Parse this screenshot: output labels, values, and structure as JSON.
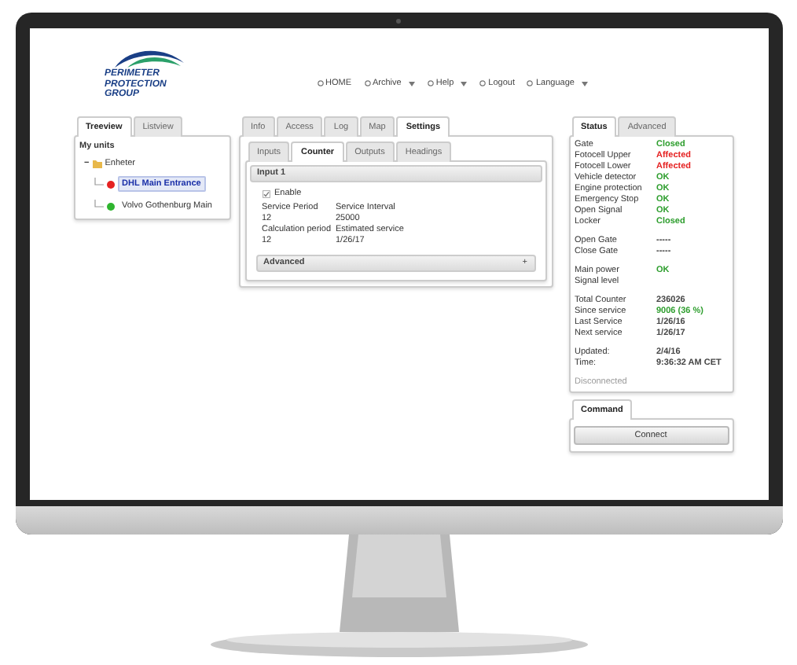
{
  "logo": {
    "lines": [
      "PERIMETER",
      "PROTECTION",
      "GROUP"
    ]
  },
  "nav": [
    {
      "label": "HOME",
      "dropdown": false
    },
    {
      "label": "Archive",
      "dropdown": true
    },
    {
      "label": "Help",
      "dropdown": true
    },
    {
      "label": "Logout",
      "dropdown": false
    },
    {
      "label": "Language",
      "dropdown": true
    }
  ],
  "left_panel": {
    "tabs": [
      {
        "label": "Treeview",
        "selected": true
      },
      {
        "label": "Listview",
        "selected": false
      }
    ],
    "heading": "My units",
    "tree": [
      {
        "label": "Enheter",
        "expanded": true,
        "toggle": "−",
        "children": [
          {
            "label": "DHL Main Entrance",
            "color": "#e52222",
            "selected": true
          },
          {
            "label": "Volvo Gothenburg Main",
            "color": "#2fb52f",
            "selected": false
          }
        ]
      }
    ]
  },
  "settings_panel": {
    "tabs": [
      {
        "label": "Info",
        "selected": false
      },
      {
        "label": "Access",
        "selected": false
      },
      {
        "label": "Log",
        "selected": false
      },
      {
        "label": "Map",
        "selected": false
      },
      {
        "label": "Settings",
        "selected": true
      }
    ],
    "subtabs": [
      {
        "label": "Inputs",
        "selected": false
      },
      {
        "label": "Counter",
        "selected": true
      },
      {
        "label": "Outputs",
        "selected": false
      },
      {
        "label": "Headings",
        "selected": false
      }
    ],
    "section": "Input 1",
    "enable": {
      "label": "Enable",
      "checked": true
    },
    "fields": [
      {
        "label": "Service Period",
        "value": "12"
      },
      {
        "label": "Service Interval",
        "value": "25000"
      },
      {
        "label": "Calculation period",
        "value": "12"
      },
      {
        "label": "Estimated service",
        "value": "1/26/17"
      }
    ],
    "advanced": {
      "label": "Advanced",
      "toggle": "+"
    }
  },
  "status_panel": {
    "tabs": [
      {
        "label": "Status",
        "selected": true
      },
      {
        "label": "Advanced",
        "selected": false
      }
    ],
    "groups": [
      [
        {
          "label": "Gate",
          "value": "Closed",
          "color": "#2e9e2e"
        },
        {
          "label": "Fotocell Upper",
          "value": "Affected",
          "color": "#e52222"
        },
        {
          "label": "Fotocell Lower",
          "value": "Affected",
          "color": "#e52222"
        },
        {
          "label": "Vehicle detector",
          "value": "OK",
          "color": "#2e9e2e"
        },
        {
          "label": "Engine protection",
          "value": "OK",
          "color": "#2e9e2e"
        },
        {
          "label": "Emergency Stop",
          "value": "OK",
          "color": "#2e9e2e"
        },
        {
          "label": "Open Signal",
          "value": "OK",
          "color": "#2e9e2e"
        },
        {
          "label": "Locker",
          "value": "Closed",
          "color": "#2e9e2e"
        }
      ],
      [
        {
          "label": "Open Gate",
          "value": "-----"
        },
        {
          "label": "Close Gate",
          "value": "-----"
        }
      ],
      [
        {
          "label": "Main power",
          "value": "OK",
          "color": "#2e9e2e"
        },
        {
          "label": "Signal level"
        }
      ],
      [
        {
          "label": "Total Counter",
          "value": "236026",
          "color": "#444444"
        },
        {
          "label": "Since service",
          "value": "9006 (36 %)",
          "color": "#2e9e2e"
        },
        {
          "label": "Last Service",
          "value": "1/26/16",
          "color": "#444444"
        },
        {
          "label": "Next service",
          "value": "1/26/17",
          "color": "#444444"
        }
      ],
      [
        {
          "label": "Updated:",
          "value": "2/4/16",
          "color": "#444444"
        },
        {
          "label": "Time:",
          "value": "9:36:32 AM CET",
          "color": "#444444"
        }
      ]
    ],
    "connection": "Disconnected",
    "command_tab": "Command",
    "connect_button": "Connect"
  }
}
